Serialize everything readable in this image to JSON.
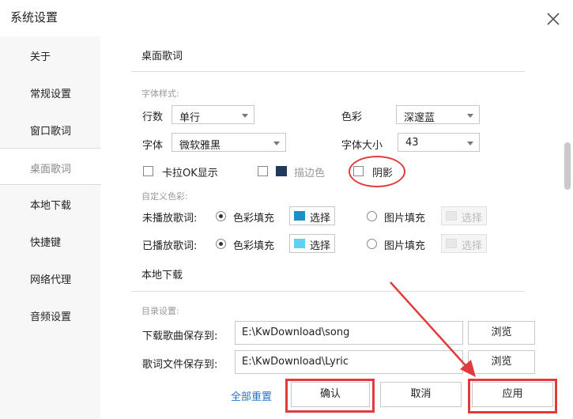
{
  "window": {
    "title": "系统设置"
  },
  "sidebar": {
    "items": [
      {
        "label": "关于"
      },
      {
        "label": "常规设置"
      },
      {
        "label": "窗口歌词"
      },
      {
        "label": "桌面歌词"
      },
      {
        "label": "本地下载"
      },
      {
        "label": "快捷键"
      },
      {
        "label": "网络代理"
      },
      {
        "label": "音频设置"
      }
    ],
    "active": "桌面歌词"
  },
  "desktop_lyrics": {
    "section_title": "桌面歌词",
    "font_style_heading": "字体样式:",
    "rows_label": "行数",
    "rows_value": "单行",
    "color_label": "色彩",
    "color_value": "深邃蓝",
    "font_label": "字体",
    "font_value": "微软雅黑",
    "font_size_label": "字体大小",
    "font_size_value": "43",
    "karaoke_label": "卡拉OK显示",
    "stroke_label": "描边色",
    "shadow_label": "阴影",
    "custom_color_heading": "自定义色彩:",
    "unplayed_label": "未播放歌词:",
    "played_label": "已播放歌词:",
    "color_fill_label": "色彩填充",
    "image_fill_label": "图片填充",
    "choose_label": "选择",
    "colors": {
      "unplayed_swatch": "#1f8fc9",
      "played_swatch": "#5fd0ee",
      "stroke_swatch": "#1f3a5a"
    }
  },
  "local_download": {
    "section_title": "本地下载",
    "dir_heading": "目录设置:",
    "song_label": "下载歌曲保存到:",
    "song_path": "E:\\KwDownload\\song",
    "lyric_label": "歌词文件保存到:",
    "lyric_path": "E:\\KwDownload\\Lyric",
    "browse_label": "浏览"
  },
  "footer": {
    "reset_label": "全部重置",
    "confirm_label": "确认",
    "cancel_label": "取消",
    "apply_label": "应用"
  },
  "annotation_colors": {
    "highlight": "#e23b3b"
  }
}
